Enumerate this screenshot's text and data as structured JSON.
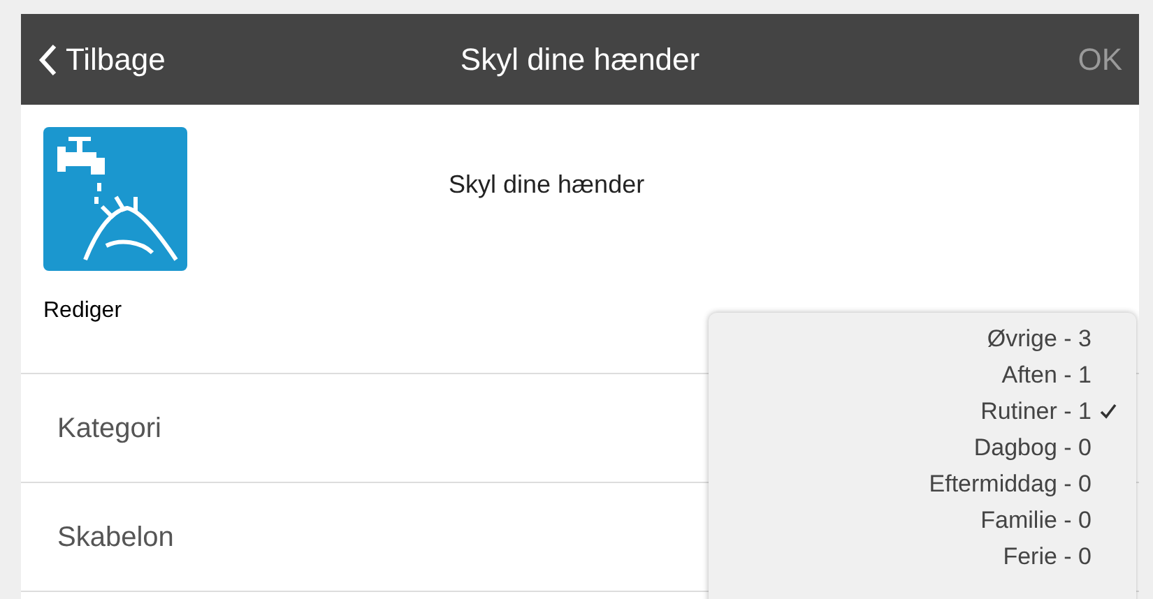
{
  "nav_bar": {
    "back": "Tilbage",
    "title": "Skyl dine hænder",
    "ok": "OK"
  },
  "task": {
    "edit": "Rediger",
    "name": "Skyl dine hænder"
  },
  "rows": [
    {
      "label": "Kategori"
    },
    {
      "label": "Skabelon"
    }
  ],
  "category_menu": [
    {
      "label": "Øvrige - 3",
      "selected": false
    },
    {
      "label": "Aften - 1",
      "selected": false
    },
    {
      "label": "Rutiner - 1",
      "selected": true
    },
    {
      "label": "Dagbog - 0",
      "selected": false
    },
    {
      "label": "Eftermiddag - 0",
      "selected": false
    },
    {
      "label": "Familie - 0",
      "selected": false
    },
    {
      "label": "Ferie - 0",
      "selected": false
    }
  ]
}
